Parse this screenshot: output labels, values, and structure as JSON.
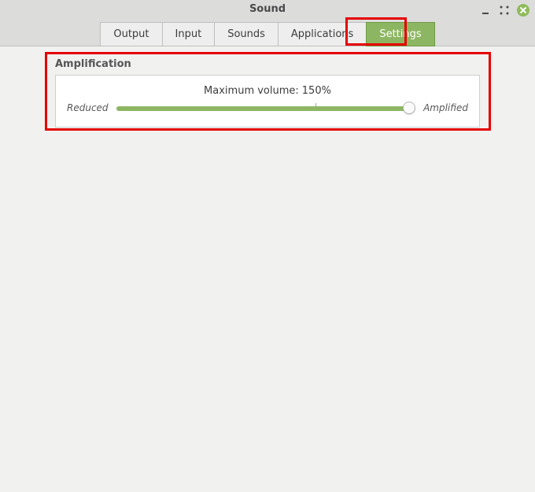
{
  "window": {
    "title": "Sound"
  },
  "tabs": [
    {
      "label": "Output",
      "active": false
    },
    {
      "label": "Input",
      "active": false
    },
    {
      "label": "Sounds",
      "active": false
    },
    {
      "label": "Applications",
      "active": false
    },
    {
      "label": "Settings",
      "active": true
    }
  ],
  "amplification": {
    "section_title": "Amplification",
    "max_volume_label": "Maximum volume:",
    "max_volume_value": "150%",
    "reduced_label": "Reduced",
    "amplified_label": "Amplified",
    "slider_percent": 150,
    "slider_max": 150
  }
}
